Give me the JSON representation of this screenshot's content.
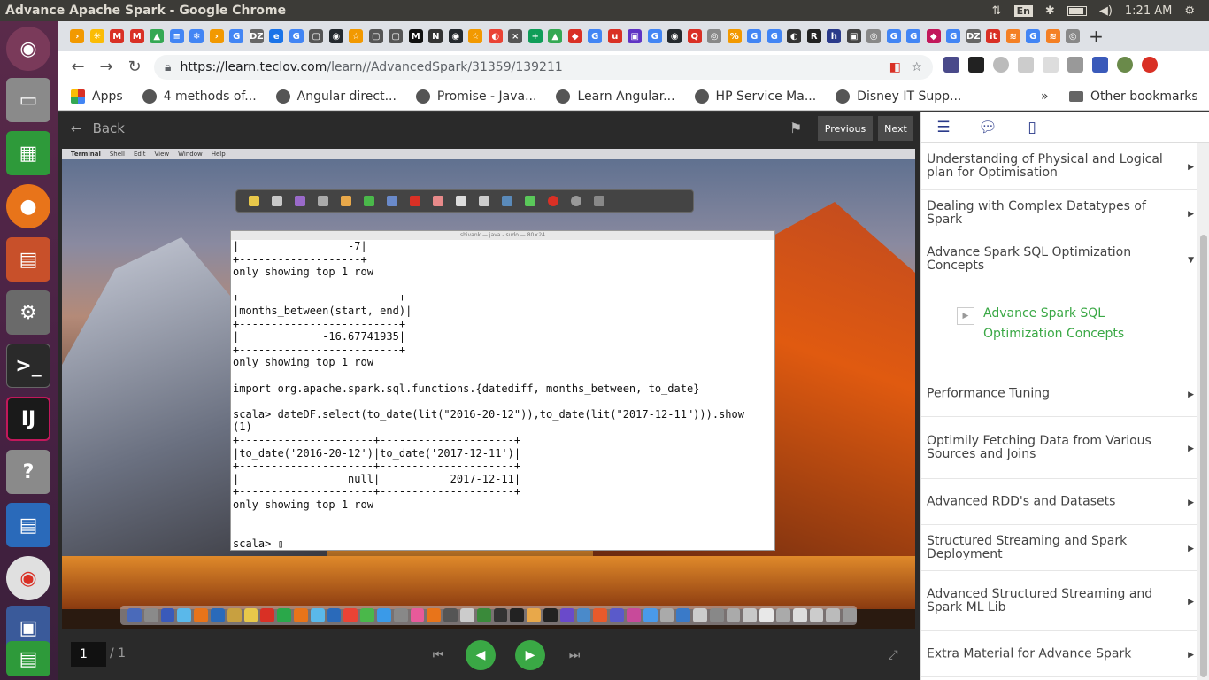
{
  "window": {
    "title": "Advance Apache Spark - Google Chrome"
  },
  "tray": {
    "lang": "En",
    "time": "1:21 AM"
  },
  "browser": {
    "url_host": "https://learn.teclov.com",
    "url_path": "/learn//AdvancedSpark/31359/139211",
    "tab_icons": [
      {
        "glyph": "›",
        "color": "#f29900"
      },
      {
        "glyph": "✳",
        "color": "#fbbc05"
      },
      {
        "glyph": "M",
        "color": "#d93025"
      },
      {
        "glyph": "M",
        "color": "#d93025"
      },
      {
        "glyph": "▲",
        "color": "#34a853"
      },
      {
        "glyph": "≡",
        "color": "#4285f4"
      },
      {
        "glyph": "❄",
        "color": "#4285f4"
      },
      {
        "glyph": "›",
        "color": "#f29900"
      },
      {
        "glyph": "G",
        "color": "#4285f4"
      },
      {
        "glyph": "DZ",
        "color": "#666666"
      },
      {
        "glyph": "e",
        "color": "#1a73e8"
      },
      {
        "glyph": "G",
        "color": "#4285f4"
      },
      {
        "glyph": "▢",
        "color": "#555555"
      },
      {
        "glyph": "◉",
        "color": "#24292e"
      },
      {
        "glyph": "☆",
        "color": "#f29900"
      },
      {
        "glyph": "▢",
        "color": "#555555"
      },
      {
        "glyph": "▢",
        "color": "#555555"
      },
      {
        "glyph": "M",
        "color": "#111111"
      },
      {
        "glyph": "N",
        "color": "#333333"
      },
      {
        "glyph": "◉",
        "color": "#24292e"
      },
      {
        "glyph": "☆",
        "color": "#f29900"
      },
      {
        "glyph": "◐",
        "color": "#ea4335"
      },
      {
        "glyph": "×",
        "color": "#555555"
      },
      {
        "glyph": "+",
        "color": "#0f9d58"
      },
      {
        "glyph": "▲",
        "color": "#34a853"
      },
      {
        "glyph": "◆",
        "color": "#d93025"
      },
      {
        "glyph": "G",
        "color": "#4285f4"
      },
      {
        "glyph": "u",
        "color": "#d93025"
      },
      {
        "glyph": "▣",
        "color": "#5f33c4"
      },
      {
        "glyph": "G",
        "color": "#4285f4"
      },
      {
        "glyph": "◉",
        "color": "#24292e"
      },
      {
        "glyph": "Q",
        "color": "#d93025"
      },
      {
        "glyph": "◎",
        "color": "#888888"
      },
      {
        "glyph": "%",
        "color": "#f29900"
      },
      {
        "glyph": "G",
        "color": "#4285f4"
      },
      {
        "glyph": "G",
        "color": "#4285f4"
      },
      {
        "glyph": "◐",
        "color": "#333333"
      },
      {
        "glyph": "R",
        "color": "#222222"
      },
      {
        "glyph": "h",
        "color": "#2a3a8a"
      },
      {
        "glyph": "▣",
        "color": "#444444"
      },
      {
        "glyph": "◎",
        "color": "#888888"
      },
      {
        "glyph": "G",
        "color": "#4285f4"
      },
      {
        "glyph": "G",
        "color": "#4285f4"
      },
      {
        "glyph": "◆",
        "color": "#c2185b"
      },
      {
        "glyph": "G",
        "color": "#4285f4"
      },
      {
        "glyph": "DZ",
        "color": "#666666"
      },
      {
        "glyph": "it",
        "color": "#d93025"
      },
      {
        "glyph": "≋",
        "color": "#f48024"
      },
      {
        "glyph": "G",
        "color": "#4285f4"
      },
      {
        "glyph": "≋",
        "color": "#f48024"
      },
      {
        "glyph": "◎",
        "color": "#888888"
      }
    ],
    "bookmarks": [
      {
        "label": "Apps",
        "icon": "apps-grid-icon"
      },
      {
        "label": "4 methods of...",
        "icon": "avatar-icon"
      },
      {
        "label": "Angular direct...",
        "icon": "globe-icon"
      },
      {
        "label": "Promise - Java...",
        "icon": "page-icon"
      },
      {
        "label": "Learn Angular...",
        "icon": "code-icon"
      },
      {
        "label": "HP Service Ma...",
        "icon": "hp-icon"
      },
      {
        "label": "Disney IT Supp...",
        "icon": "disney-icon"
      }
    ],
    "overflow": "»",
    "other_bookmarks": "Other bookmarks"
  },
  "viewer": {
    "back_label": "Back",
    "previous_label": "Previous",
    "next_label": "Next",
    "page_current": "1",
    "page_total": "/ 1"
  },
  "terminal": {
    "title": "shivank — java - sudo — 80×24",
    "lines": [
      "|                 -7|",
      "+-------------------+",
      "only showing top 1 row",
      "",
      "+-------------------------+",
      "|months_between(start, end)|",
      "+-------------------------+",
      "|             -16.67741935|",
      "+-------------------------+",
      "only showing top 1 row",
      "",
      "import org.apache.spark.sql.functions.{datediff, months_between, to_date}",
      "",
      "scala> dateDF.select(to_date(lit(\"2016-20-12\")),to_date(lit(\"2017-12-11\"))).show",
      "(1)",
      "+---------------------+---------------------+",
      "|to_date('2016-20-12')|to_date('2017-12-11')|",
      "+---------------------+---------------------+",
      "|                 null|           2017-12-11|",
      "+---------------------+---------------------+",
      "only showing top 1 row",
      "",
      "",
      "scala> ▯"
    ]
  },
  "mac_menu": [
    "Terminal",
    "Shell",
    "Edit",
    "View",
    "Window",
    "Help"
  ],
  "sidebar": {
    "items": [
      {
        "label": "Understanding of Physical and Logical plan for Optimisation",
        "arrow": "▶"
      },
      {
        "label": "Dealing with Complex Datatypes of Spark",
        "arrow": "▶"
      },
      {
        "label": "Advance Spark SQL Optimization Concepts",
        "arrow": "▼"
      },
      {
        "label": "Performance Tuning",
        "arrow": "▶"
      },
      {
        "label": "Optimily Fetching Data from Various Sources and Joins",
        "arrow": "▶"
      },
      {
        "label": "Advanced RDD's and Datasets",
        "arrow": "▶"
      },
      {
        "label": "Structured Streaming and Spark Deployment",
        "arrow": "▶"
      },
      {
        "label": "Advanced Structured Streaming and Spark ML Lib",
        "arrow": "▶"
      },
      {
        "label": "Extra Material for Advance Spark",
        "arrow": "▶"
      }
    ],
    "active_sub": "Advance Spark SQL Optimization Concepts"
  },
  "colors": {
    "accent_green": "#3aa845",
    "link_blue": "#2a3a8a"
  }
}
